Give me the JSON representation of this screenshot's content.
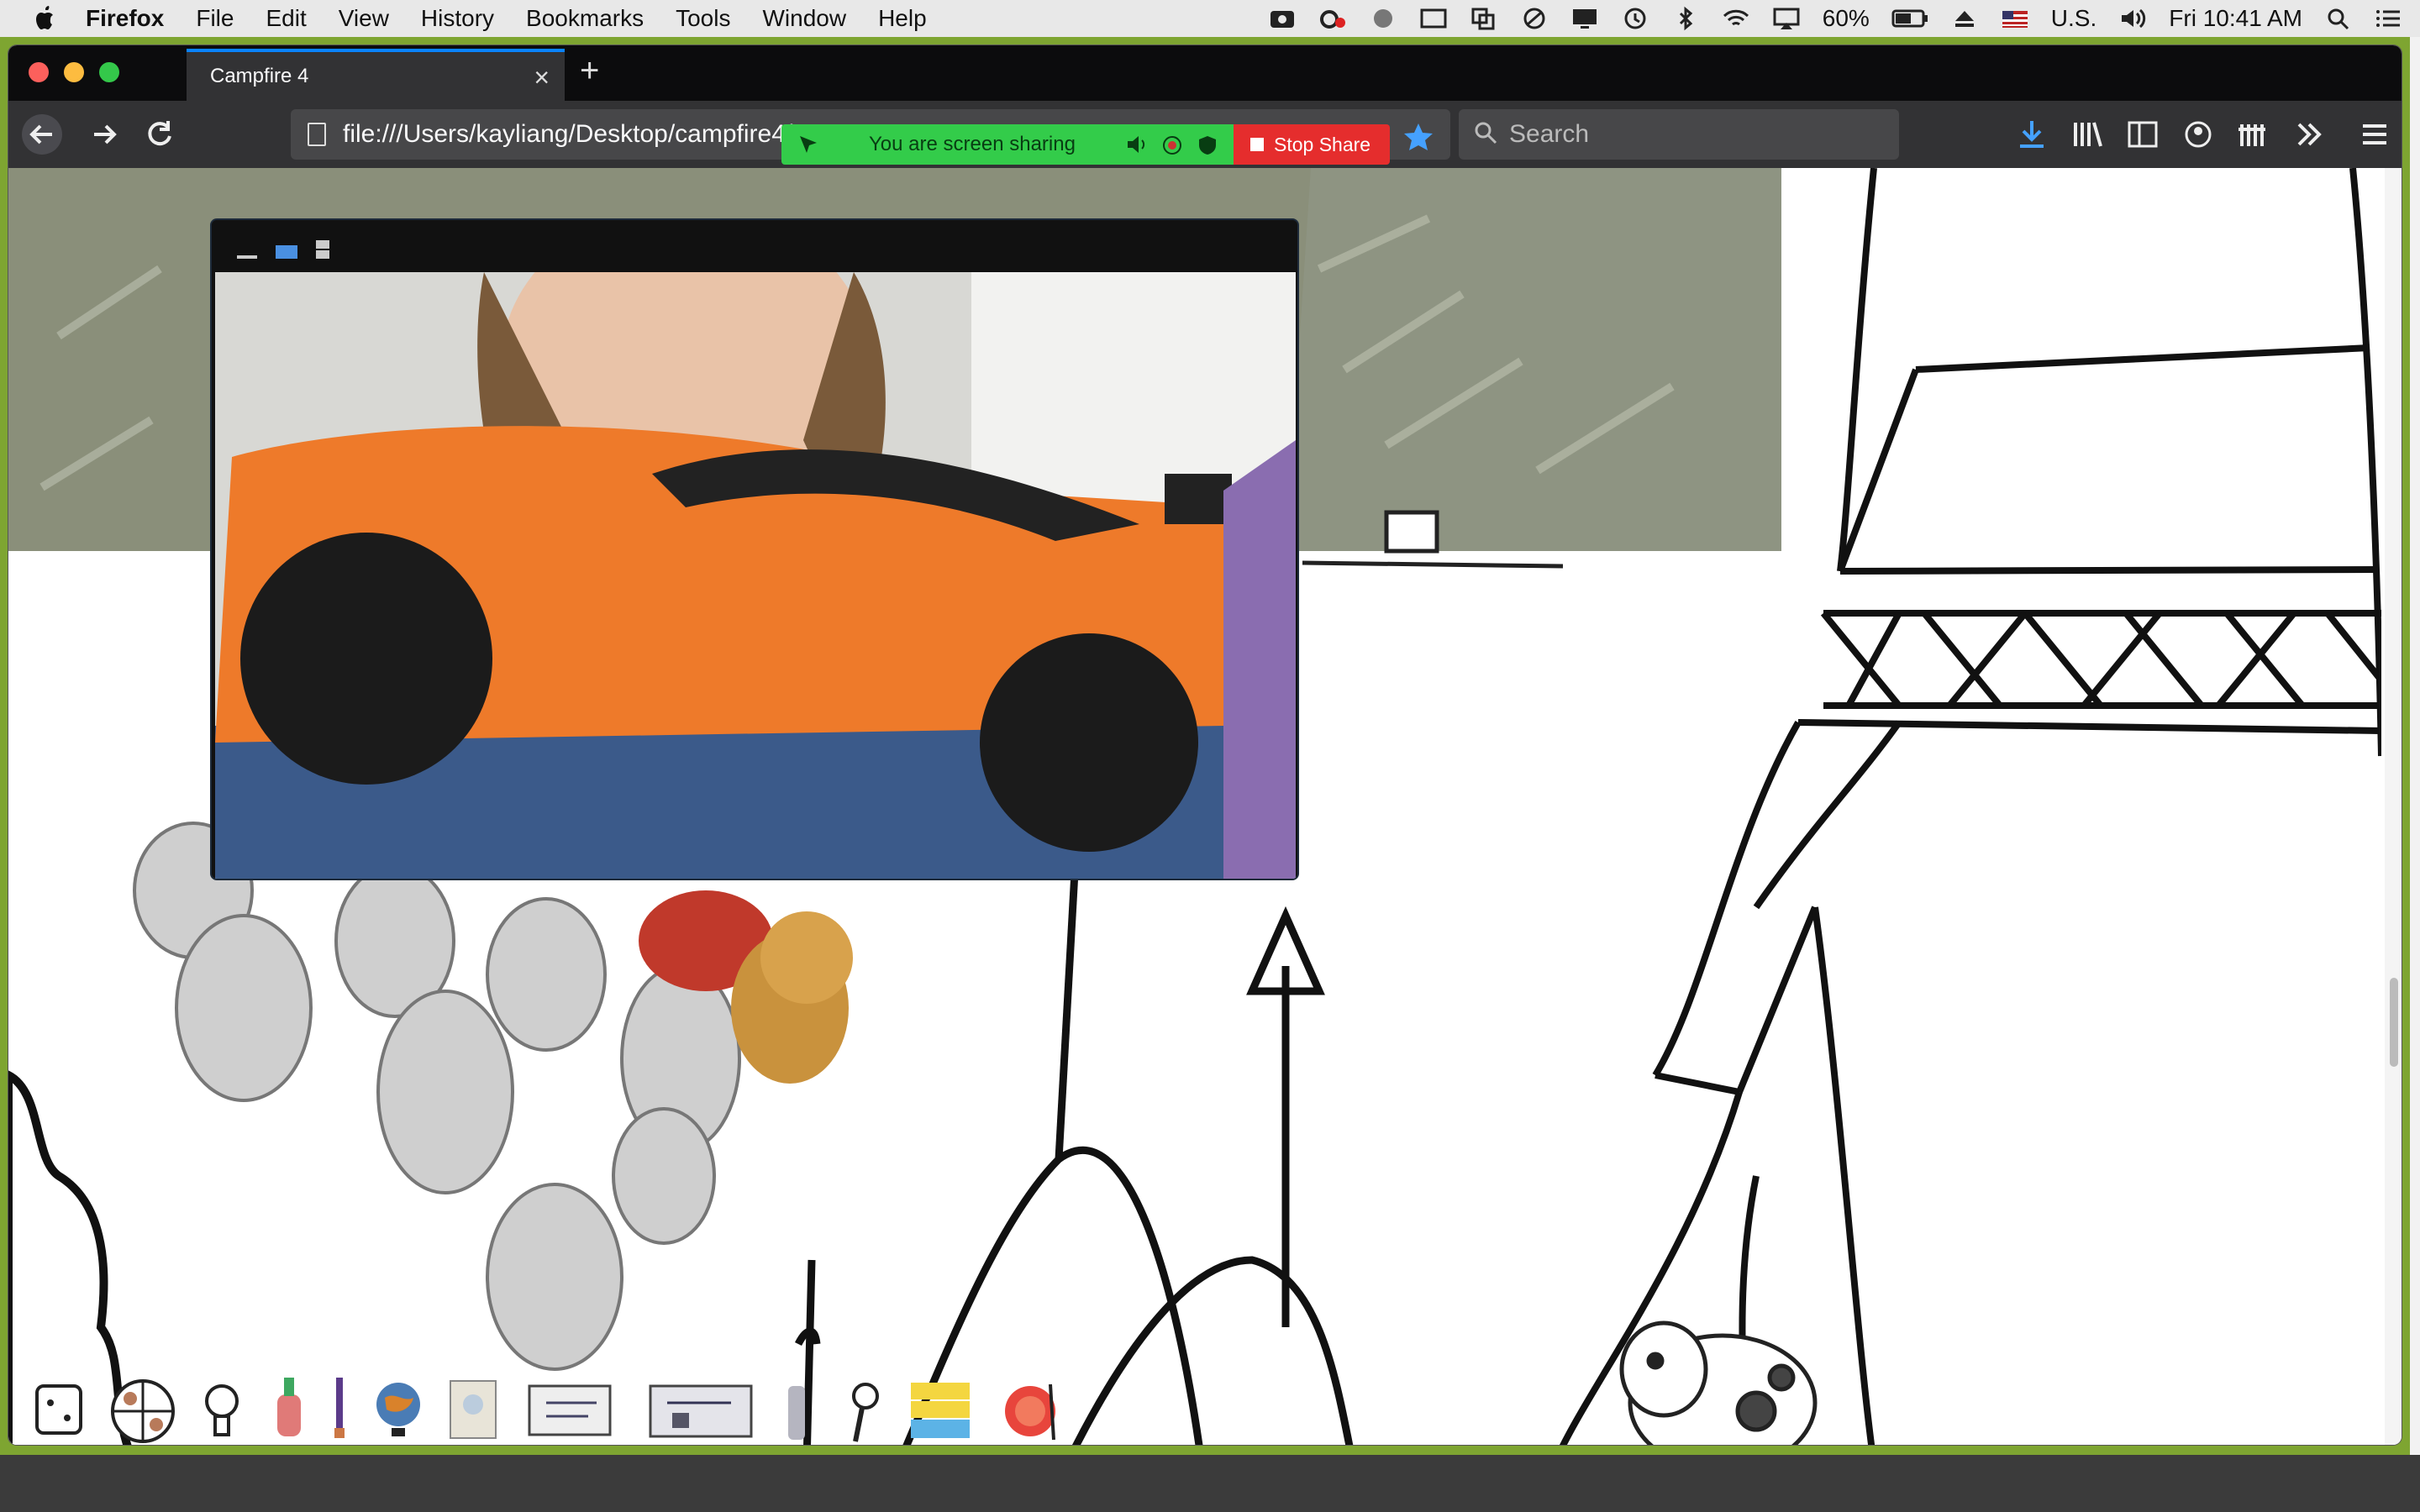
{
  "menubar": {
    "app_name": "Firefox",
    "items": [
      "File",
      "Edit",
      "View",
      "History",
      "Bookmarks",
      "Tools",
      "Window",
      "Help"
    ],
    "battery": "60%",
    "input_source": "U.S.",
    "clock": "Fri 10:41 AM"
  },
  "browser": {
    "tab_title": "Campfire 4",
    "url": "file:///Users/kayliang/Desktop/campfire4/",
    "search_placeholder": "Search"
  },
  "share_banner": {
    "status": "You are screen sharing",
    "stop_label": "Stop Share"
  },
  "scene_items": [
    "dice-icon",
    "spinner-wheel-icon",
    "lightbulb-icon",
    "bottle-icon",
    "paintbrush-icon",
    "globe-icon",
    "passport-card",
    "drawing-card",
    "bridge-card",
    "bottle-small",
    "magnifier-icon",
    "sticky-notes",
    "fruit-icon"
  ],
  "colors": {
    "menubar_bg": "#e8e8e8",
    "tabstrip_bg": "#0c0c0d",
    "navbar_bg": "#323234",
    "share_green": "#33cc4a",
    "share_red": "#e52d2d",
    "accent_blue": "#0a84ff"
  }
}
